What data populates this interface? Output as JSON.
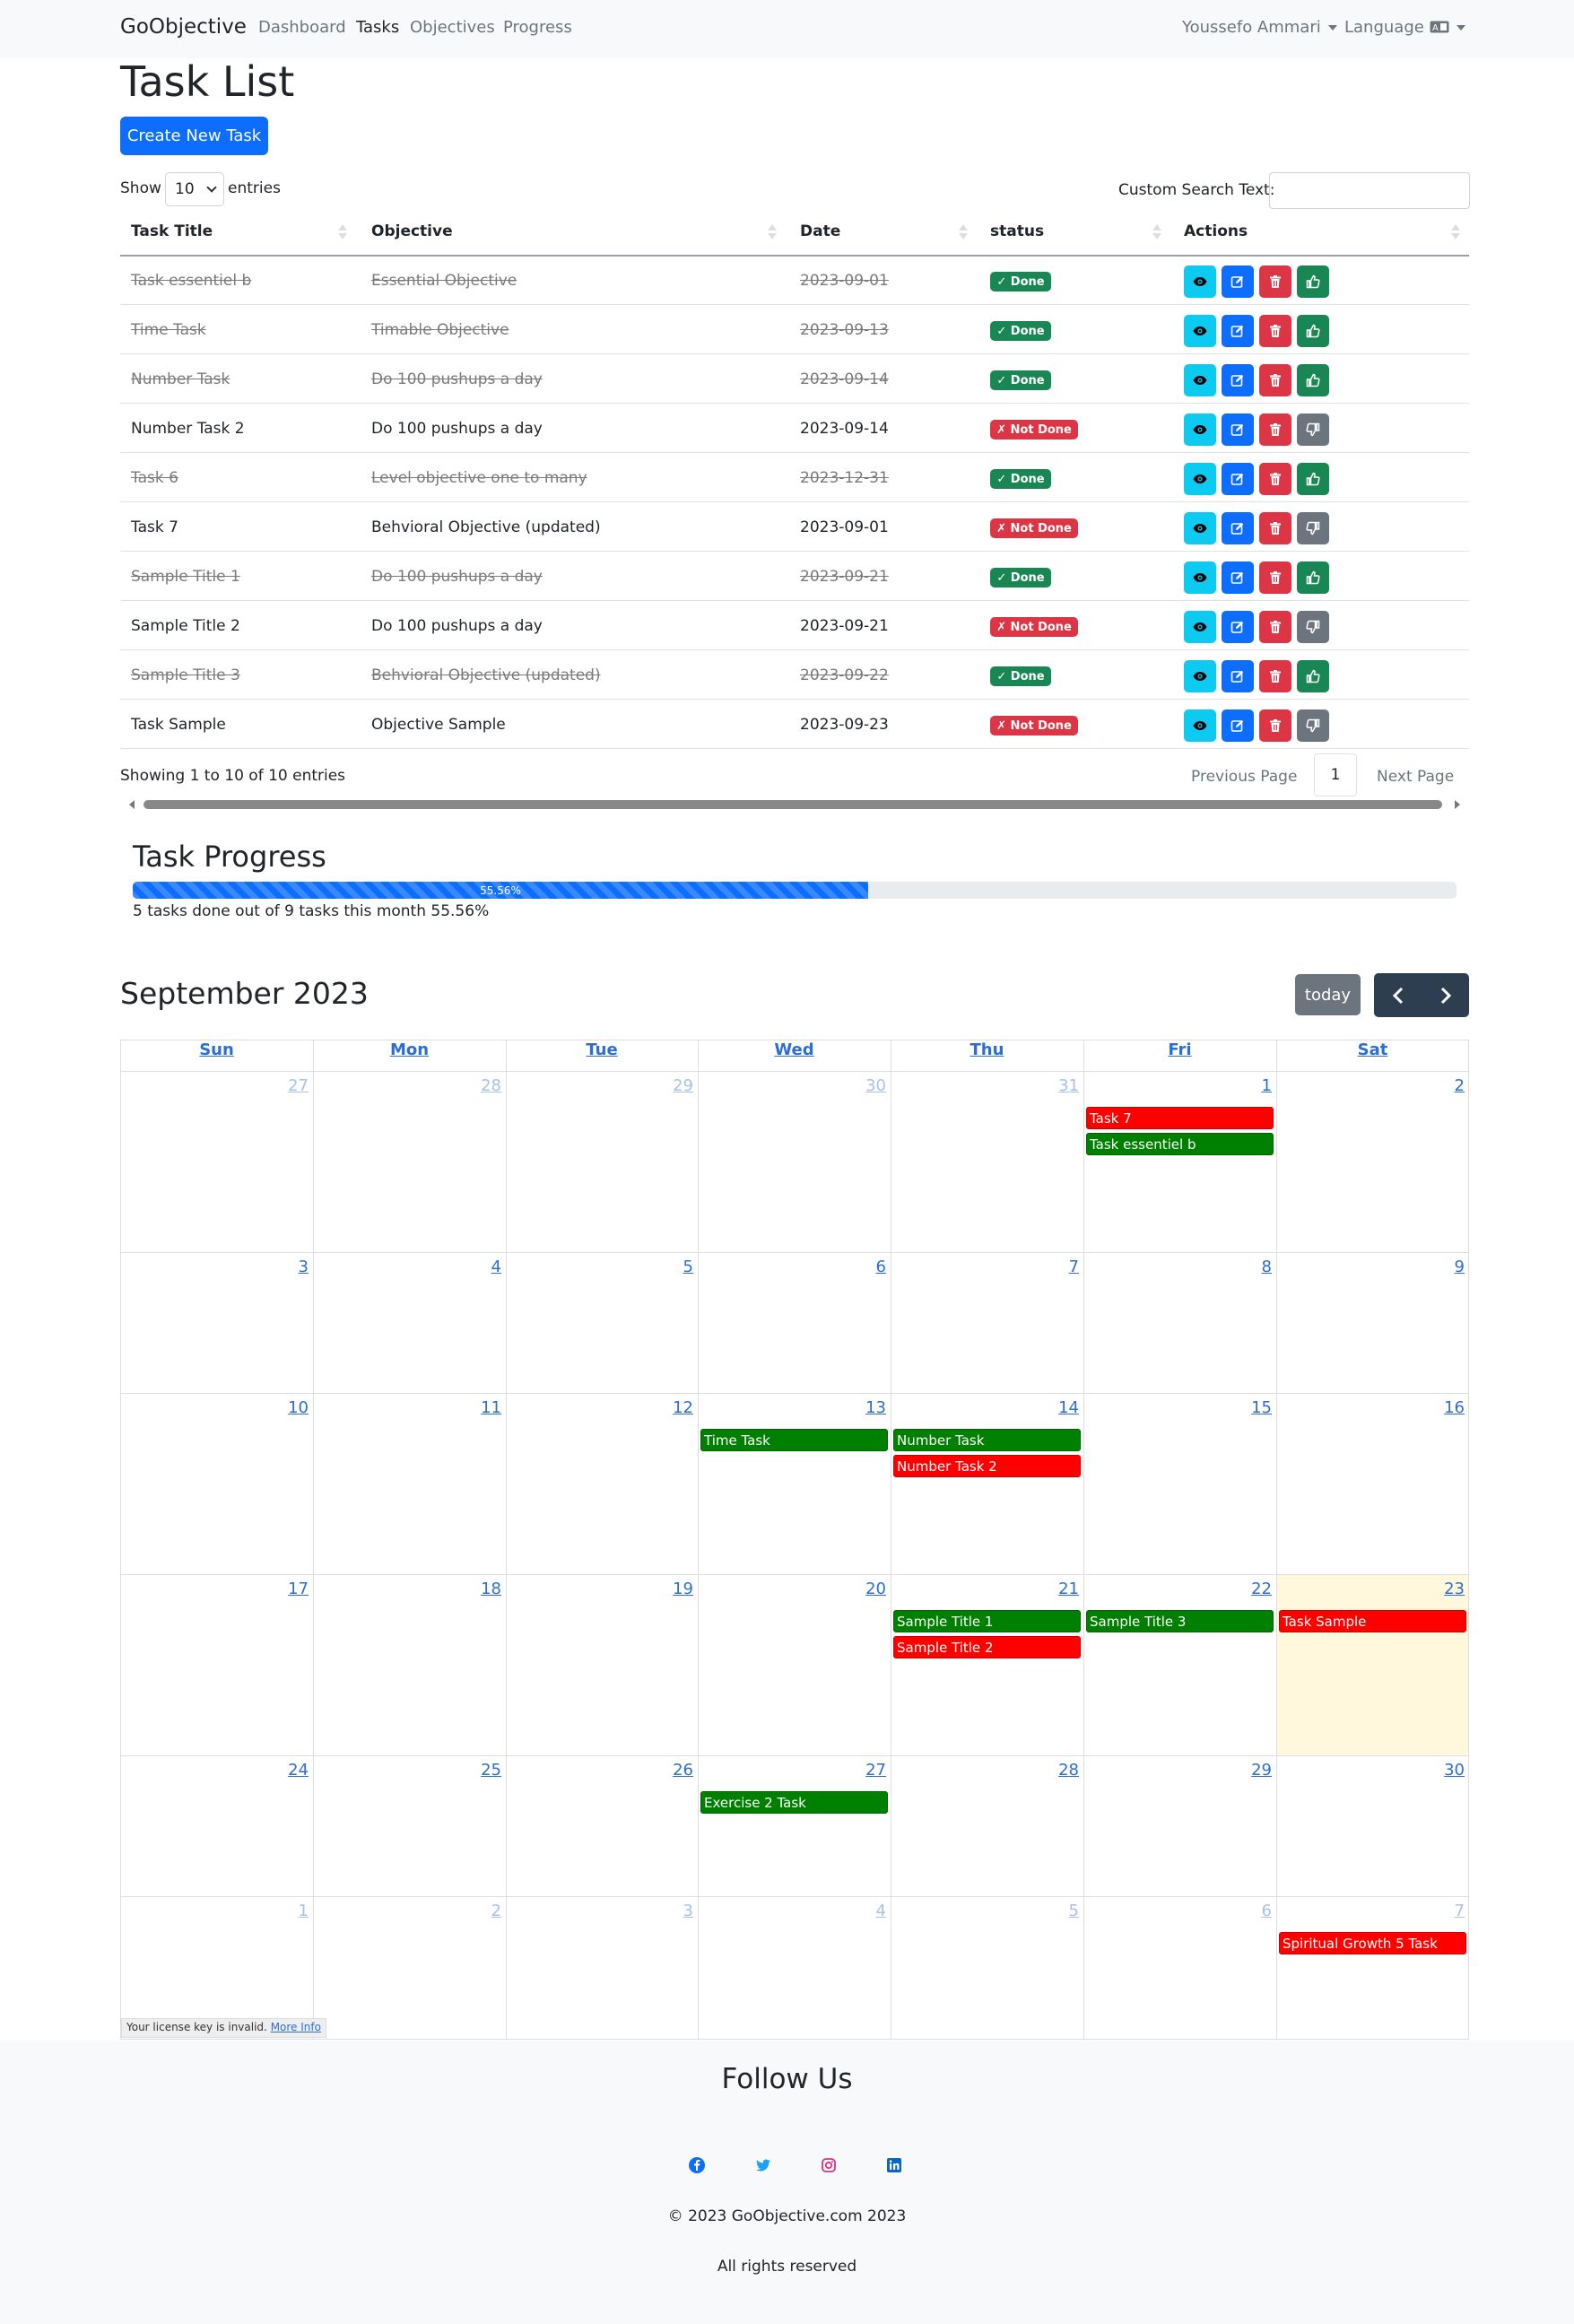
{
  "navbar": {
    "brand": "GoObjective",
    "links": [
      "Dashboard",
      "Tasks",
      "Objectives",
      "Progress"
    ],
    "user": "Youssefo Ammari",
    "language": "Language"
  },
  "page": {
    "title": "Task List",
    "create_button": "Create New Task"
  },
  "table_controls": {
    "show_label": "Show",
    "entries_value": "10",
    "entries_label": "entries",
    "search_label": "Custom Search Text:"
  },
  "table": {
    "columns": [
      "Task Title",
      "Objective",
      "Date",
      "status",
      "Actions"
    ],
    "rows": [
      {
        "title": "Task essentiel b",
        "objective": "Essential Objective",
        "date": "2023-09-01",
        "status": "✓ Done",
        "done": true
      },
      {
        "title": "Time Task",
        "objective": "Timable Objective",
        "date": "2023-09-13",
        "status": "✓ Done",
        "done": true
      },
      {
        "title": "Number Task",
        "objective": "Do 100 pushups a day",
        "date": "2023-09-14",
        "status": "✓ Done",
        "done": true
      },
      {
        "title": "Number Task 2",
        "objective": "Do 100 pushups a day",
        "date": "2023-09-14",
        "status": "✗ Not Done",
        "done": false
      },
      {
        "title": "Task 6",
        "objective": "Level objective one to many",
        "date": "2023-12-31",
        "status": "✓ Done",
        "done": true
      },
      {
        "title": "Task 7",
        "objective": "Behvioral Objective (updated)",
        "date": "2023-09-01",
        "status": "✗ Not Done",
        "done": false
      },
      {
        "title": "Sample Title 1",
        "objective": "Do 100 pushups a day",
        "date": "2023-09-21",
        "status": "✓ Done",
        "done": true
      },
      {
        "title": "Sample Title 2",
        "objective": "Do 100 pushups a day",
        "date": "2023-09-21",
        "status": "✗ Not Done",
        "done": false
      },
      {
        "title": "Sample Title 3",
        "objective": "Behvioral Objective (updated)",
        "date": "2023-09-22",
        "status": "✓ Done",
        "done": true
      },
      {
        "title": "Task Sample",
        "objective": "Objective Sample",
        "date": "2023-09-23",
        "status": "✗ Not Done",
        "done": false
      }
    ],
    "info": "Showing 1 to 10 of 10 entries",
    "prev": "Previous Page",
    "page": "1",
    "next": "Next Page"
  },
  "progress": {
    "heading": "Task Progress",
    "percent_label": "55.56%",
    "percent": 55.56,
    "caption": "5 tasks done out of 9 tasks this month 55.56%"
  },
  "calendar": {
    "title": "September 2023",
    "today_button": "today",
    "day_names": [
      "Sun",
      "Mon",
      "Tue",
      "Wed",
      "Thu",
      "Fri",
      "Sat"
    ],
    "weeks": [
      [
        "27",
        "28",
        "29",
        "30",
        "31",
        "1",
        "2"
      ],
      [
        "3",
        "4",
        "5",
        "6",
        "7",
        "8",
        "9"
      ],
      [
        "10",
        "11",
        "12",
        "13",
        "14",
        "15",
        "16"
      ],
      [
        "17",
        "18",
        "19",
        "20",
        "21",
        "22",
        "23"
      ],
      [
        "24",
        "25",
        "26",
        "27",
        "28",
        "29",
        "30"
      ],
      [
        "1",
        "2",
        "3",
        "4",
        "5",
        "6",
        "7"
      ]
    ],
    "events": [
      {
        "title": "Task 7",
        "week": 0,
        "day": 5,
        "slot": 0,
        "color": "red"
      },
      {
        "title": "Task essentiel b",
        "week": 0,
        "day": 5,
        "slot": 1,
        "color": "green"
      },
      {
        "title": "Time Task",
        "week": 2,
        "day": 3,
        "slot": 0,
        "color": "green"
      },
      {
        "title": "Number Task",
        "week": 2,
        "day": 4,
        "slot": 0,
        "color": "green"
      },
      {
        "title": "Number Task 2",
        "week": 2,
        "day": 4,
        "slot": 1,
        "color": "red"
      },
      {
        "title": "Sample Title 1",
        "week": 3,
        "day": 4,
        "slot": 0,
        "color": "green"
      },
      {
        "title": "Sample Title 2",
        "week": 3,
        "day": 4,
        "slot": 1,
        "color": "red"
      },
      {
        "title": "Sample Title 3",
        "week": 3,
        "day": 5,
        "slot": 0,
        "color": "green"
      },
      {
        "title": "Task Sample",
        "week": 3,
        "day": 6,
        "slot": 0,
        "color": "red"
      },
      {
        "title": "Exercise 2 Task",
        "week": 4,
        "day": 3,
        "slot": 0,
        "color": "green"
      },
      {
        "title": "Spiritual Growth 5 Task",
        "week": 5,
        "day": 6,
        "slot": 0,
        "color": "red"
      }
    ],
    "license_text": "Your license key is invalid.",
    "license_link": "More Info"
  },
  "footer": {
    "title": "Follow Us",
    "social_icons": [
      "facebook-icon",
      "twitter-icon",
      "instagram-icon",
      "linkedin-icon"
    ],
    "copyright": "© 2023 GoObjective.com 2023",
    "rights": "All rights reserved"
  }
}
